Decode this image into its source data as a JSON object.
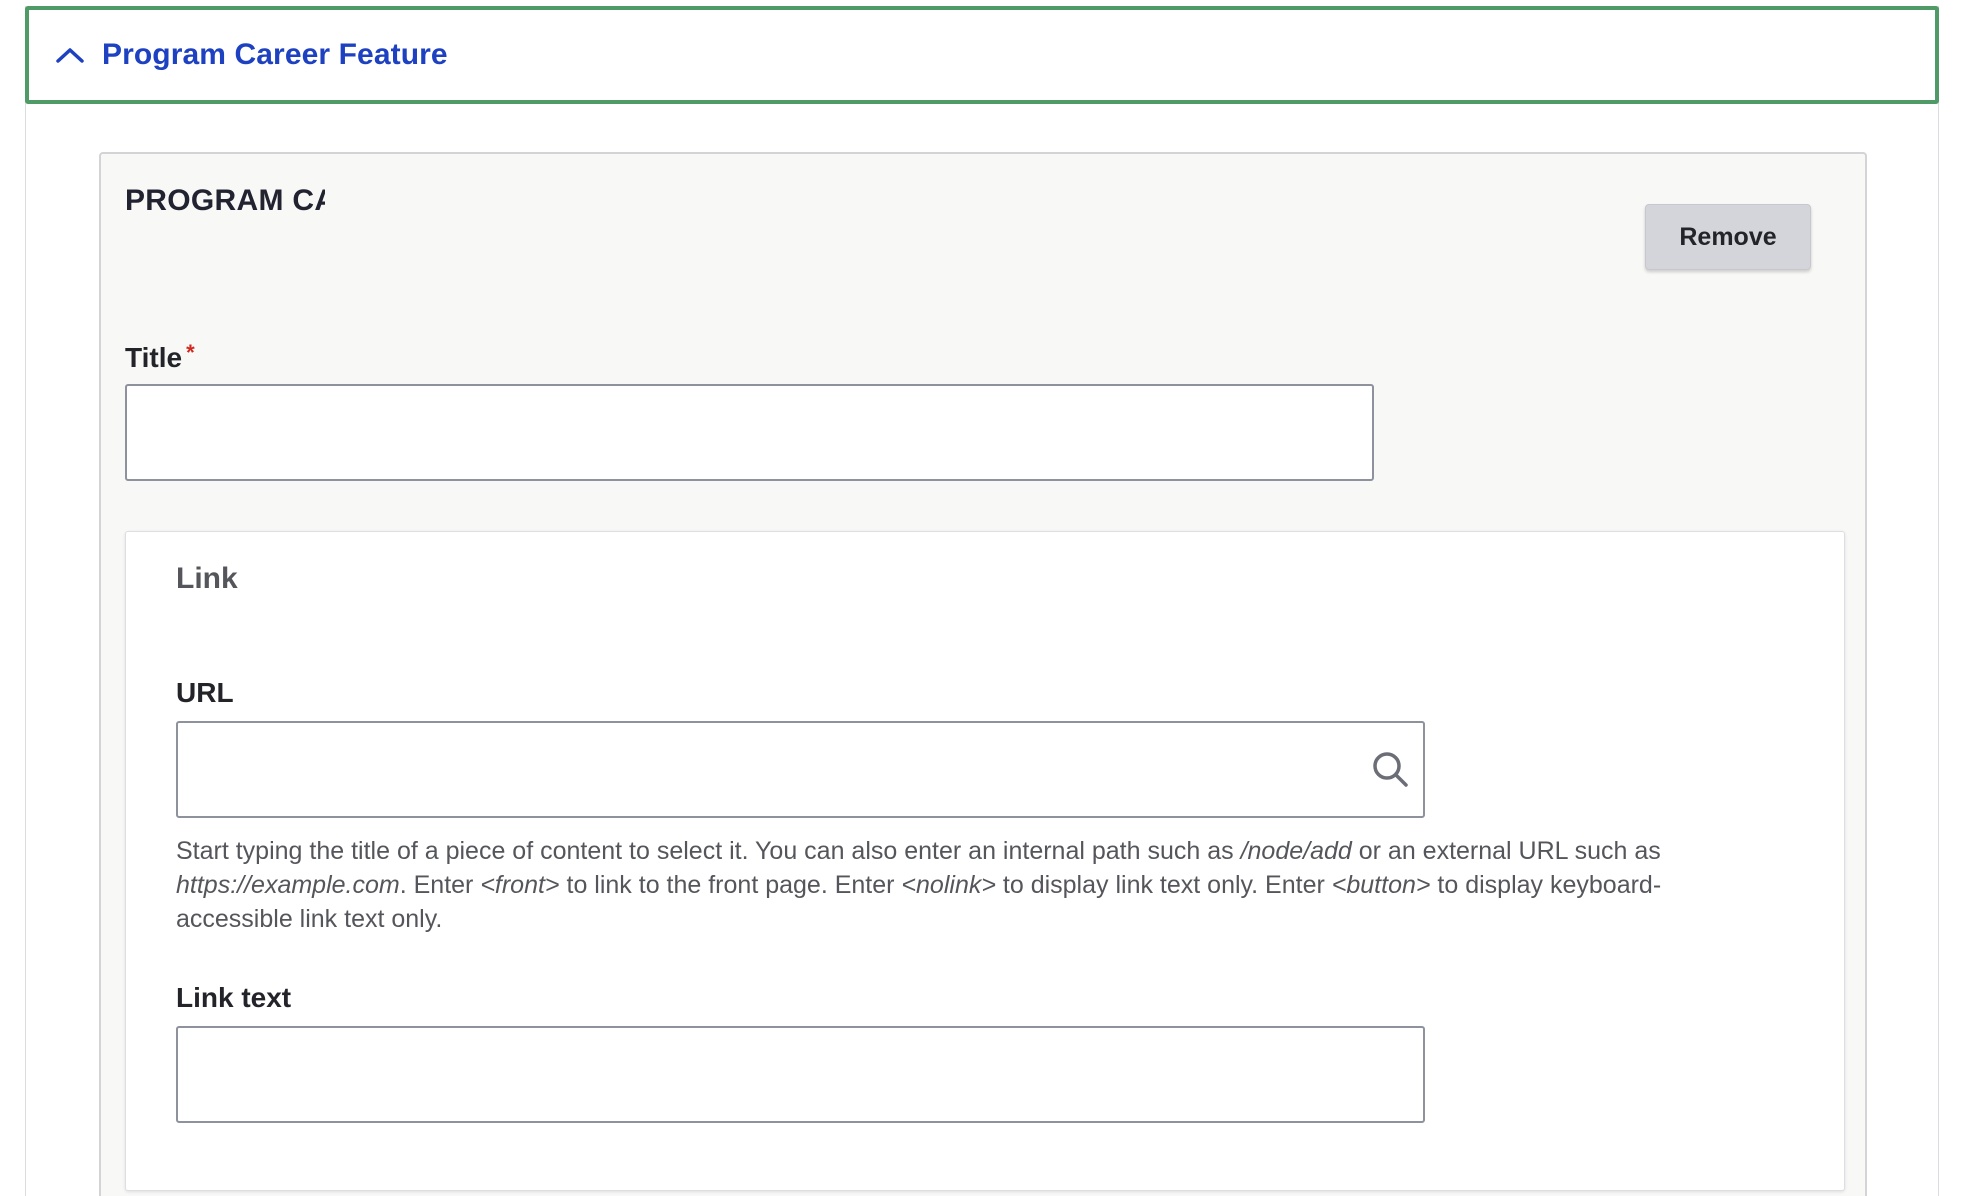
{
  "summary": {
    "title": "Program Career Feature"
  },
  "paragraph": {
    "label": "PROGRAM CAREER FEATURE",
    "remove_label": "Remove",
    "title_field": {
      "label": "Title",
      "required_mark": "*",
      "value": ""
    },
    "link": {
      "legend": "Link",
      "url_label": "URL",
      "url_value": "",
      "description": {
        "t1": "Start typing the title of a piece of content to select it. You can also enter an internal path such as ",
        "e1": "/node/add",
        "t2": " or an external URL such as ",
        "e2": "https://example.com",
        "t3": ". Enter ",
        "e3": "<front>",
        "t4": " to link to the front page. Enter ",
        "e4": "<nolink>",
        "t5": " to display link text only. Enter ",
        "e5": "<button>",
        "t6": " to display keyboard-accessible link text only."
      },
      "link_text_label": "Link text",
      "link_text_value": ""
    }
  },
  "colors": {
    "summary_title": "#1d41c1",
    "focus_outline": "#4f9a66",
    "required": "#d0281e",
    "panel_bg": "#f8f8f7",
    "button_bg": "#d4d5da"
  },
  "icons": {
    "summary_toggle": "chevron-up-icon",
    "url_autocomplete": "search-icon"
  }
}
